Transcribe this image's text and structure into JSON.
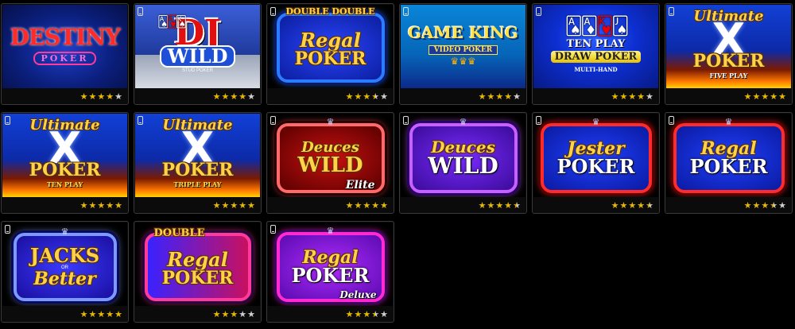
{
  "games": [
    {
      "id": "destiny",
      "lines": [
        "DESTINY",
        "POKER"
      ],
      "rating": 4,
      "mobile": false
    },
    {
      "id": "dj-wild",
      "lines": [
        "DJ",
        "WILD",
        "STUD POKER"
      ],
      "rating": 4,
      "mobile": true
    },
    {
      "id": "double-double-regal",
      "lines": [
        "DOUBLE DOUBLE",
        "Regal",
        "POKER"
      ],
      "rating": 3.5,
      "mobile": true
    },
    {
      "id": "game-king",
      "lines": [
        "GAME KING",
        "VIDEO POKER"
      ],
      "rating": 4,
      "mobile": true
    },
    {
      "id": "ten-play-draw",
      "lines": [
        "TEN PLAY",
        "DRAW POKER",
        "MULTI-HAND"
      ],
      "rating": 4,
      "mobile": true
    },
    {
      "id": "ultimate-x-five",
      "lines": [
        "Ultimate",
        "X",
        "POKER",
        "FIVE PLAY"
      ],
      "rating": 5,
      "mobile": true
    },
    {
      "id": "ultimate-x-ten",
      "lines": [
        "Ultimate",
        "X",
        "POKER",
        "TEN PLAY"
      ],
      "rating": 5,
      "mobile": true
    },
    {
      "id": "ultimate-x-triple",
      "lines": [
        "Ultimate",
        "X",
        "POKER",
        "TRIPLE PLAY"
      ],
      "rating": 5,
      "mobile": true
    },
    {
      "id": "deuces-wild-elite",
      "lines": [
        "Deuces",
        "WILD",
        "Elite"
      ],
      "rating": 5,
      "mobile": true
    },
    {
      "id": "deuces-wild",
      "lines": [
        "Deuces",
        "WILD"
      ],
      "rating": 4.5,
      "mobile": true
    },
    {
      "id": "jester-poker",
      "lines": [
        "Jester",
        "POKER"
      ],
      "rating": 4.5,
      "mobile": true
    },
    {
      "id": "regal-poker",
      "lines": [
        "Regal",
        "POKER"
      ],
      "rating": 3.5,
      "mobile": true
    },
    {
      "id": "jacks-or-better",
      "lines": [
        "JACKS",
        "OR",
        "Better"
      ],
      "rating": 5,
      "mobile": true
    },
    {
      "id": "double-regal",
      "lines": [
        "DOUBLE",
        "Regal",
        "POKER"
      ],
      "rating": 3,
      "mobile": false
    },
    {
      "id": "regal-poker-deluxe",
      "lines": [
        "Regal",
        "POKER",
        "Deluxe"
      ],
      "rating": 3.5,
      "mobile": true
    }
  ],
  "icons": {
    "mobile": "mobile-phone-icon",
    "star": "star-icon"
  },
  "colors": {
    "background": "#000000",
    "tile_border": "#3a3a3a",
    "star_on": "#e6b800",
    "star_off": "#cfcfcf"
  }
}
